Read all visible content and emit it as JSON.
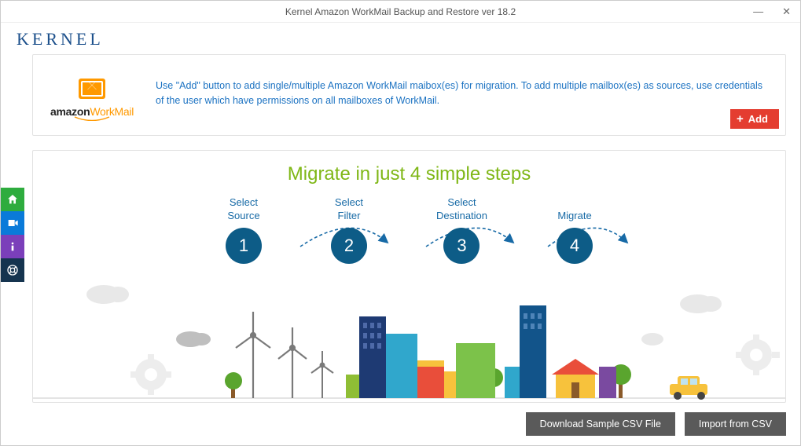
{
  "window": {
    "title": "Kernel Amazon WorkMail Backup and Restore ver 18.2"
  },
  "brand": {
    "logo_text": "KERNEL"
  },
  "amazon": {
    "name_left": "amazon",
    "name_right": "WorkMail"
  },
  "info": {
    "text": "Use \"Add\" button to add single/multiple Amazon WorkMail maibox(es) for migration. To add multiple mailbox(es) as sources, use credentials of the user which have permissions on all mailboxes of WorkMail."
  },
  "buttons": {
    "add": "Add",
    "download_csv": "Download Sample CSV File",
    "import_csv": "Import from CSV"
  },
  "steps": {
    "heading": "Migrate in just 4 simple steps",
    "items": [
      {
        "label_line1": "Select",
        "label_line2": "Source",
        "num": "1"
      },
      {
        "label_line1": "Select",
        "label_line2": "Filter",
        "num": "2"
      },
      {
        "label_line1": "Select",
        "label_line2": "Destination",
        "num": "3"
      },
      {
        "label_line1": "Migrate",
        "label_line2": "",
        "num": "4"
      }
    ]
  }
}
